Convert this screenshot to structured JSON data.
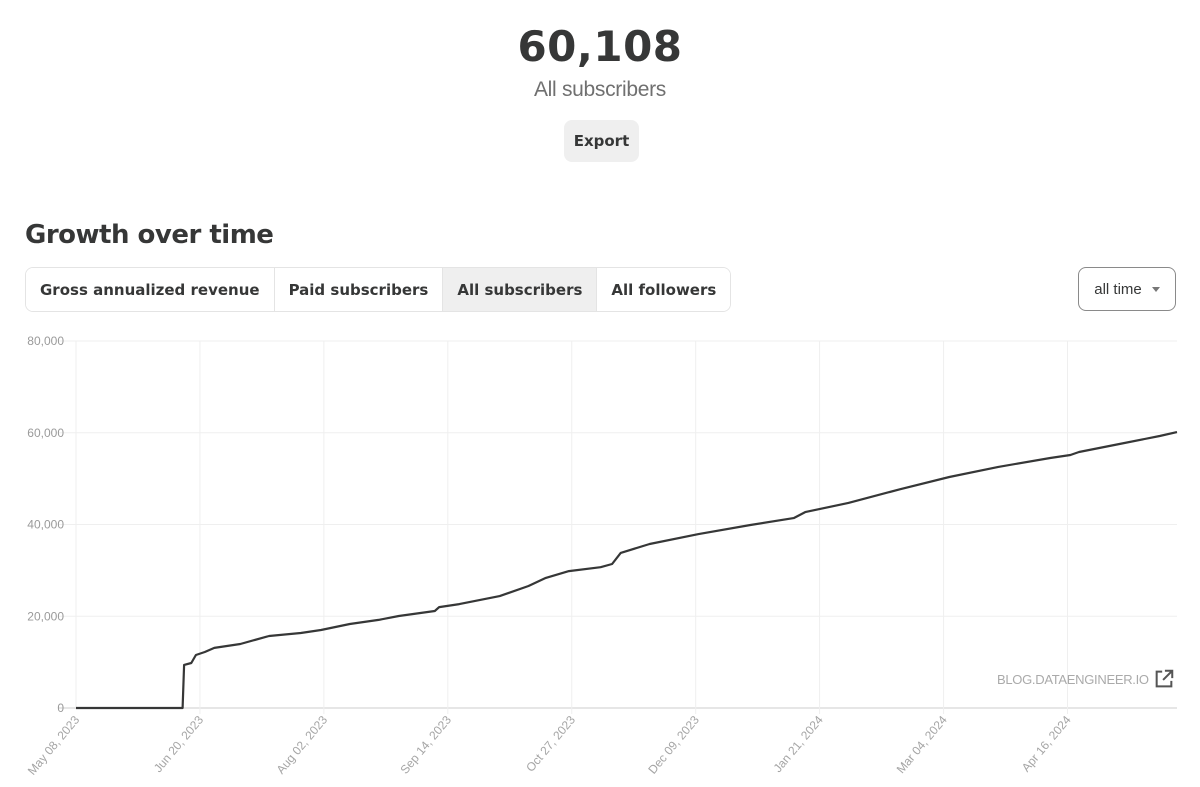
{
  "header": {
    "total_count": "60,108",
    "total_label": "All subscribers",
    "export_label": "Export"
  },
  "section": {
    "title": "Growth over time",
    "tabs": [
      {
        "label": "Gross annualized revenue",
        "active": false
      },
      {
        "label": "Paid subscribers",
        "active": false
      },
      {
        "label": "All subscribers",
        "active": true
      },
      {
        "label": "All followers",
        "active": false
      }
    ],
    "range_select": {
      "selected": "all time",
      "icon": "caret-down-icon"
    }
  },
  "watermark": {
    "text": "BLOG.DATAENGINEER.IO",
    "icon": "external-link-icon"
  },
  "colors": {
    "line": "#363737",
    "grid": "#efefef",
    "axis": "#dddddd",
    "tick_text": "#a0a0a0"
  },
  "chart_data": {
    "type": "line",
    "title": "",
    "xlabel": "",
    "ylabel": "",
    "ylim": [
      0,
      80000
    ],
    "yticks": [
      0,
      20000,
      40000,
      60000,
      80000
    ],
    "ytick_labels": [
      "0",
      "20,000",
      "40,000",
      "60,000",
      "80,000"
    ],
    "x_start": "2023-05-08",
    "x_end_days": 382,
    "xticks_days": [
      0,
      43,
      86,
      129,
      172,
      215,
      258,
      301,
      344
    ],
    "xtick_labels": [
      "May 08, 2023",
      "Jun 20, 2023",
      "Aug 02, 2023",
      "Sep 14, 2023",
      "Oct 27, 2023",
      "Dec 09, 2023",
      "Jan 21, 2024",
      "Mar 04, 2024",
      "Apr 16, 2024"
    ],
    "grid": true,
    "legend": "none",
    "series": [
      {
        "name": "All subscribers",
        "x_days": [
          0,
          37,
          37.5,
          40,
          41.6,
          44.7,
          48,
          57,
          67,
          78,
          85,
          95,
          105,
          112,
          124.5,
          126,
          133,
          147,
          157,
          163,
          171,
          182,
          186,
          189,
          199,
          216,
          234,
          249,
          253,
          268,
          286,
          303,
          320,
          338,
          345,
          348,
          362,
          376,
          382
        ],
        "values": [
          0,
          0,
          9400,
          9800,
          11550,
          12200,
          13100,
          13950,
          15700,
          16350,
          17000,
          18300,
          19200,
          20050,
          21150,
          22000,
          22650,
          24400,
          26600,
          28350,
          29850,
          30700,
          31400,
          33800,
          35750,
          37900,
          39900,
          41400,
          42700,
          44700,
          47700,
          50350,
          52550,
          54500,
          55150,
          55800,
          57550,
          59300,
          60150
        ]
      }
    ]
  }
}
